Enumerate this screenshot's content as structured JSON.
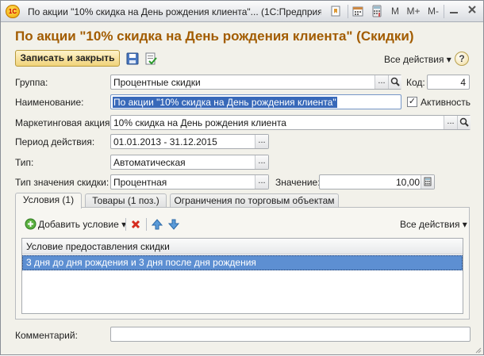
{
  "window": {
    "title": "По акции \"10% скидка на День рождения клиента\"... (1С:Предприятие)",
    "app_icon_text": "1С",
    "toolbar_buttons": [
      "M",
      "M+",
      "M-"
    ]
  },
  "heading": "По акции \"10% скидка на День рождения клиента\" (Скидки)",
  "commandbar": {
    "save_close_label": "Записать и закрыть",
    "all_actions_label": "Все действия ▾",
    "help_label": "?"
  },
  "form": {
    "group": {
      "label": "Группа:",
      "value": "Процентные скидки"
    },
    "code": {
      "label": "Код:",
      "value": "4"
    },
    "name": {
      "label": "Наименование:",
      "value": "По акции \"10% скидка на День рождения клиента\""
    },
    "active": {
      "label": "Активность",
      "checked": true
    },
    "promo": {
      "label": "Маркетинговая акция:",
      "value": "10% скидка на День рождения клиента"
    },
    "period": {
      "label": "Период действия:",
      "value": "01.01.2013 - 31.12.2015"
    },
    "type": {
      "label": "Тип:",
      "value": "Автоматическая"
    },
    "value_type": {
      "label": "Тип значения скидки:",
      "value": "Процентная"
    },
    "amount": {
      "label": "Значение:",
      "value": "10,00"
    },
    "comment": {
      "label": "Комментарий:",
      "value": ""
    }
  },
  "tabs": [
    {
      "label": "Условия (1)",
      "active": true
    },
    {
      "label": "Товары (1 поз.)",
      "active": false
    },
    {
      "label": "Ограничения по торговым объектам",
      "active": false
    }
  ],
  "conditions": {
    "add_label": "Добавить условие ▾",
    "all_actions_label": "Все действия ▾",
    "column_header": "Условие предоставления скидки",
    "rows": [
      "3 дня до дня рождения  и 3 дня после дня рождения"
    ]
  },
  "colors": {
    "heading": "#a25c00",
    "selection": "#5d8fd2",
    "button": "#f0d37a"
  }
}
